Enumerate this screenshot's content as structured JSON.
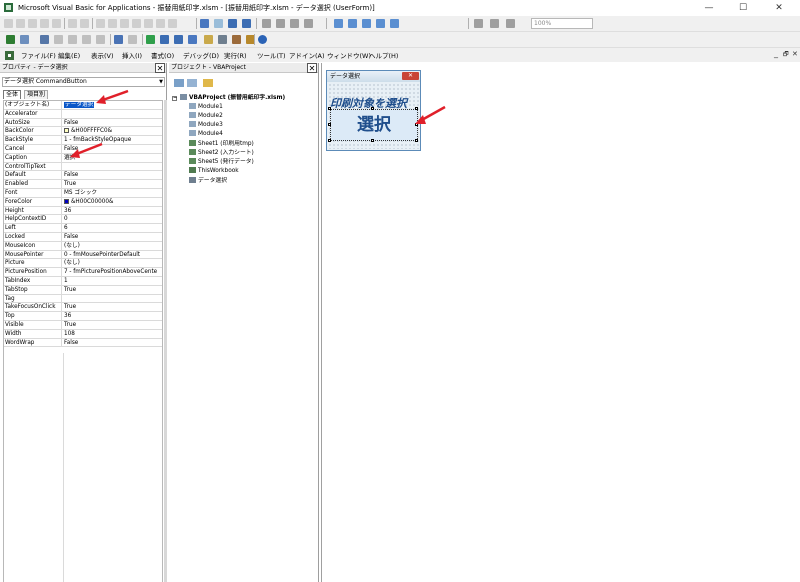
{
  "window": {
    "title": "Microsoft Visual Basic for Applications - 振替用紙印字.xlsm - [振替用紙印字.xlsm - データ選択 (UserForm)]",
    "min_label": "—",
    "max_label": "☐",
    "close_label": "✕"
  },
  "toolbar": {
    "zoom_value": "100%"
  },
  "menu": {
    "items": [
      "ファイル(F)",
      "編集(E)",
      "表示(V)",
      "挿入(I)",
      "書式(O)",
      "デバッグ(D)",
      "実行(R)",
      "ツール(T)",
      "アドイン(A)",
      "ウィンドウ(W)",
      "ヘルプ(H)"
    ]
  },
  "mdi": {
    "min": "_",
    "restore": "🗗",
    "close": "✕"
  },
  "properties": {
    "pane_title": "プロパティ - データ選択",
    "object_selector": "データ選択 CommandButton",
    "tab_all": "全体",
    "tab_category": "項目別",
    "rows": [
      {
        "name": "(オブジェクト名)",
        "value": "データ選択"
      },
      {
        "name": "Accelerator",
        "value": ""
      },
      {
        "name": "AutoSize",
        "value": "False"
      },
      {
        "name": "BackColor",
        "value": "&H00FFFFC0&"
      },
      {
        "name": "BackStyle",
        "value": "1 - fmBackStyleOpaque"
      },
      {
        "name": "Cancel",
        "value": "False"
      },
      {
        "name": "Caption",
        "value": "選択"
      },
      {
        "name": "ControlTipText",
        "value": ""
      },
      {
        "name": "Default",
        "value": "False"
      },
      {
        "name": "Enabled",
        "value": "True"
      },
      {
        "name": "Font",
        "value": "MS ゴシック"
      },
      {
        "name": "ForeColor",
        "value": "&H00C00000&"
      },
      {
        "name": "Height",
        "value": "36"
      },
      {
        "name": "HelpContextID",
        "value": "0"
      },
      {
        "name": "Left",
        "value": "6"
      },
      {
        "name": "Locked",
        "value": "False"
      },
      {
        "name": "MouseIcon",
        "value": "(なし)"
      },
      {
        "name": "MousePointer",
        "value": "0 - fmMousePointerDefault"
      },
      {
        "name": "Picture",
        "value": "(なし)"
      },
      {
        "name": "PicturePosition",
        "value": "7 - fmPicturePositionAboveCente"
      },
      {
        "name": "TabIndex",
        "value": "1"
      },
      {
        "name": "TabStop",
        "value": "True"
      },
      {
        "name": "Tag",
        "value": ""
      },
      {
        "name": "TakeFocusOnClick",
        "value": "True"
      },
      {
        "name": "Top",
        "value": "36"
      },
      {
        "name": "Visible",
        "value": "True"
      },
      {
        "name": "Width",
        "value": "108"
      },
      {
        "name": "WordWrap",
        "value": "False"
      }
    ],
    "backcolor_swatch": "#ffffc0",
    "forecolor_swatch": "#0000c0"
  },
  "project": {
    "pane_title": "プロジェクト - VBAProject",
    "root": "VBAProject (振替用紙印字.xlsm)",
    "items": [
      "Module1",
      "Module2",
      "Module3",
      "Module4",
      "Sheet1 (印刷用tmp)",
      "Sheet2 (入力シート)",
      "Sheet5 (発行データ)",
      "ThisWorkbook",
      "データ選択"
    ]
  },
  "userform": {
    "title": "データ選択",
    "close_label": "✕",
    "label_text": "印刷対象を選択",
    "button_caption": "選択"
  },
  "colors": {
    "accent": "#0a57c8",
    "arrow": "#e0202a",
    "form_text": "#1f4e8c"
  }
}
